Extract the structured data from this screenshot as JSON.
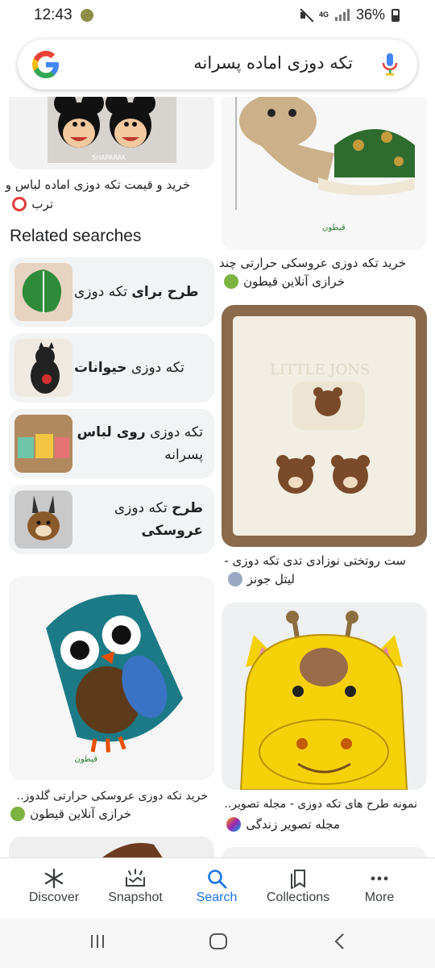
{
  "status_bar": {
    "time": "12:43",
    "network": "4G",
    "battery": "36%"
  },
  "search": {
    "query": "تکه دوزی اماده پسرانه"
  },
  "results": {
    "left_top": {
      "caption_line1": "خرید و قیمت تکه دوزی اماده لباس و",
      "caption_line2": "ترب"
    },
    "right_top": {
      "caption": "خرید تکه دوزی عروسکی حرارتی چند",
      "source": "خرازی آنلاین قیطون",
      "watermark": "قیطون"
    },
    "right_middle": {
      "caption": "ست روتختی نوزادی تدی تکه دوزی -",
      "source": "لیتل جونز",
      "image_text": "LITTLE JONS"
    },
    "left_owl": {
      "caption": "خرید تکه دوزی عروسکی حرارتی گلدوز..",
      "source": "خرازی آنلاین قیطون",
      "watermark": "قیطون"
    },
    "right_giraffe": {
      "caption": "نمونه طرح های تکه دوزی - مجله تصویر..",
      "source": "مجله تصویر زندگی"
    },
    "left_top_image_text": "SHAPARAK"
  },
  "related": {
    "title": "Related searches",
    "items": [
      {
        "bold": "طرح برای",
        "normal": "تکه دوزی"
      },
      {
        "normal": "تکه دوزی",
        "bold": "حیوانات"
      },
      {
        "normal": "تکه دوزی",
        "bold": "روی لباس",
        "normal2": "پسرانه"
      },
      {
        "bold": "طرح",
        "normal": "تکه دوزی",
        "bold2": "عروسکی"
      }
    ]
  },
  "bottom_nav": {
    "items": [
      {
        "label": "Discover",
        "icon": "asterisk-icon"
      },
      {
        "label": "Snapshot",
        "icon": "snapshot-icon"
      },
      {
        "label": "Search",
        "icon": "search-icon"
      },
      {
        "label": "Collections",
        "icon": "collections-icon"
      },
      {
        "label": "More",
        "icon": "more-dots-icon"
      }
    ],
    "active": "Search"
  },
  "colors": {
    "accent": "#1a73e8",
    "chip_bg": "#f1f3f4"
  }
}
